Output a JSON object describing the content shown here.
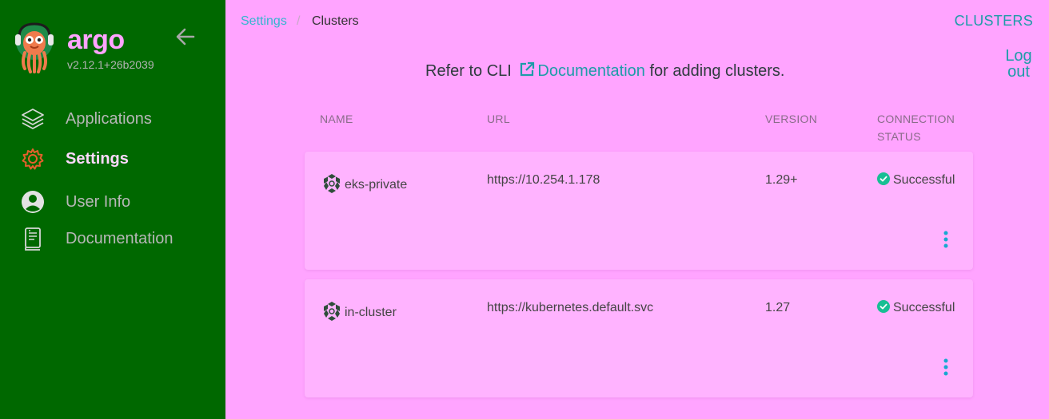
{
  "sidebar": {
    "brand": "argo",
    "version": "v2.12.1+26b2039",
    "items": [
      {
        "label": "Applications",
        "icon": "layers-icon"
      },
      {
        "label": "Settings",
        "icon": "gear-icon"
      },
      {
        "label": "User Info",
        "icon": "user-circle-icon"
      },
      {
        "label": "Documentation",
        "icon": "book-icon"
      }
    ],
    "active_item": "Settings"
  },
  "breadcrumb": {
    "parent": "Settings",
    "separator": "/",
    "current": "Clusters"
  },
  "header": {
    "title": "CLUSTERS",
    "logout_line1": "Log",
    "logout_line2": "out"
  },
  "notice": {
    "prefix": "Refer to CLI",
    "link": "Documentation",
    "suffix": "for adding clusters."
  },
  "table": {
    "columns": [
      "NAME",
      "URL",
      "VERSION",
      "CONNECTION",
      "STATUS"
    ],
    "rows": [
      {
        "name": "eks-private",
        "url": "https://10.254.1.178",
        "version": "1.29+",
        "status": "Successful"
      },
      {
        "name": "in-cluster",
        "url": "https://kubernetes.default.svc",
        "version": "1.27",
        "status": "Successful"
      }
    ]
  },
  "colors": {
    "sidebar_bg": "#006800",
    "page_bg": "#ffa4ff",
    "accent": "#1d9ca8",
    "success": "#18be94"
  }
}
